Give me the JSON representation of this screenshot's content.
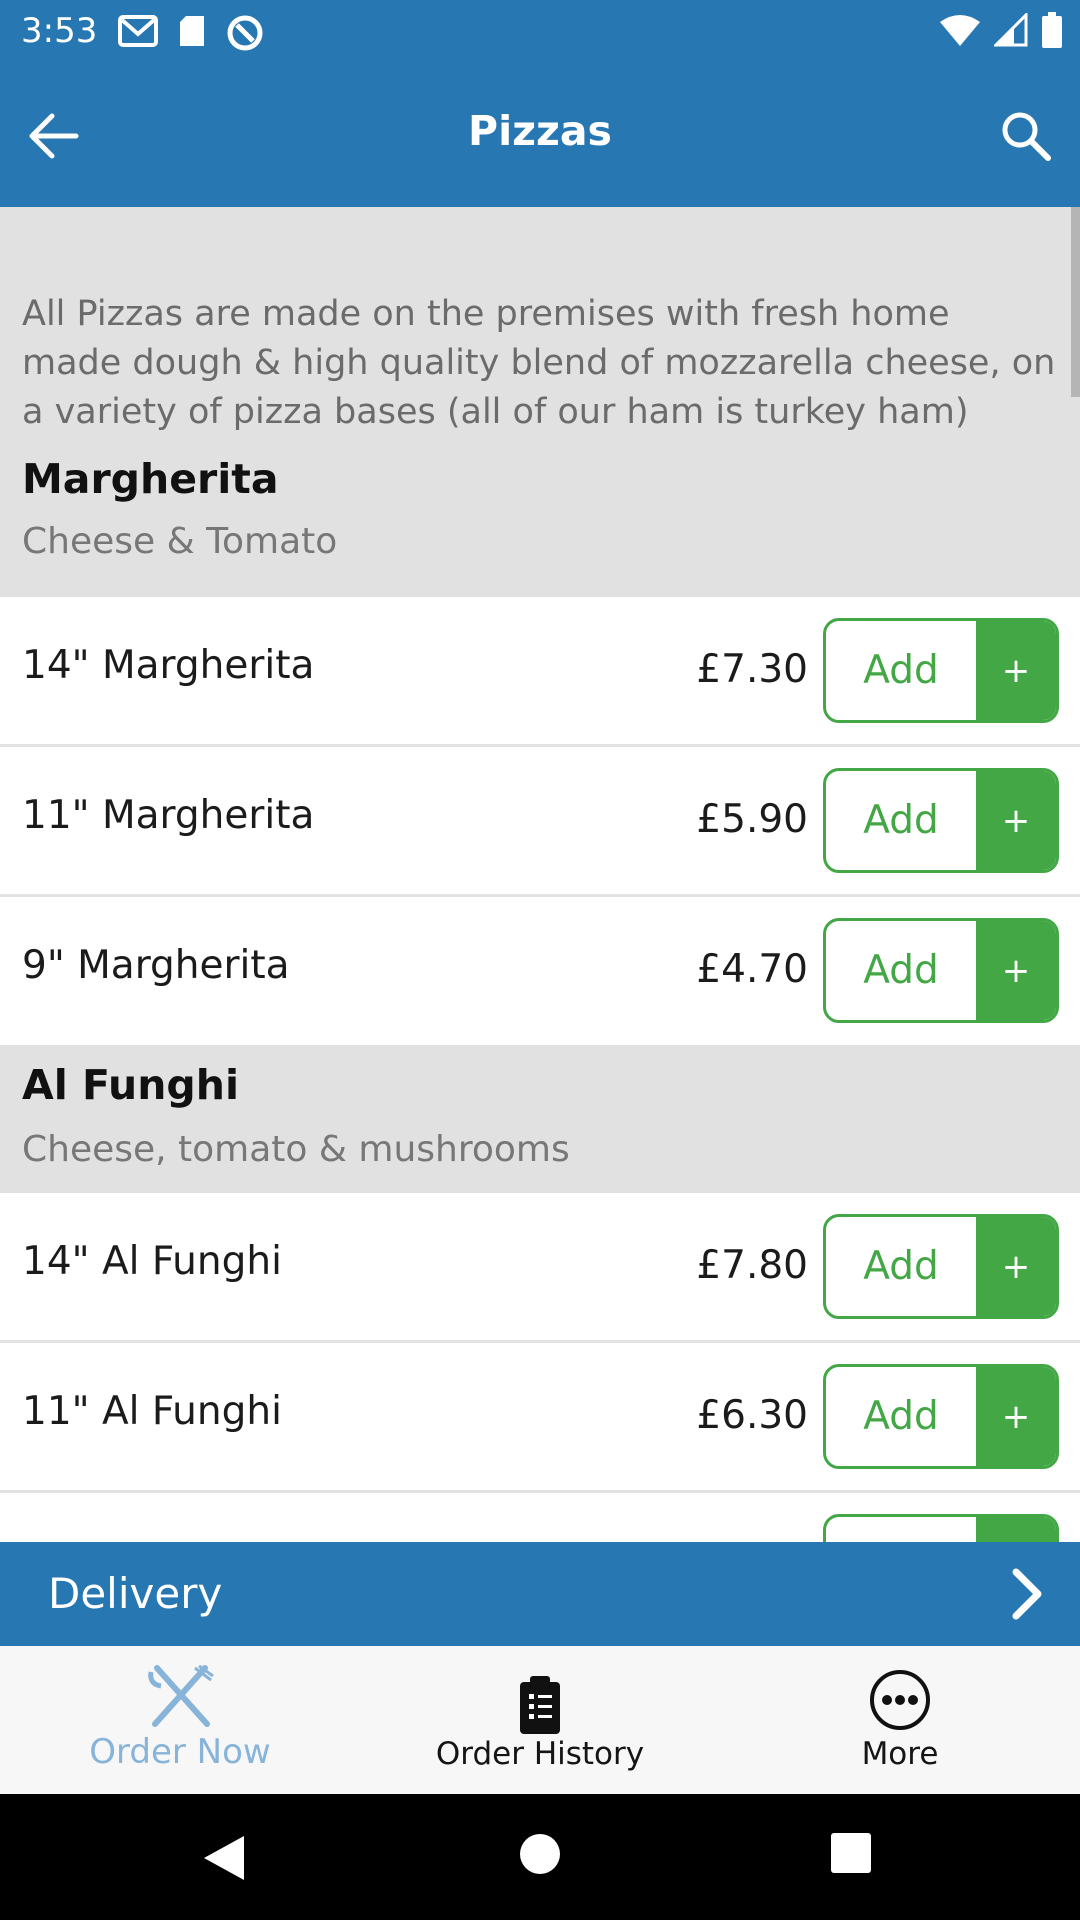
{
  "status_bar": {
    "time": "3:53"
  },
  "app_bar": {
    "title": "Pizzas"
  },
  "intro_text": "All Pizzas are made on the premises with fresh home made dough & high quality blend of mozzarella cheese, on a variety of pizza bases (all of our ham is turkey ham)",
  "sections": [
    {
      "name": "Margherita",
      "description": "Cheese & Tomato",
      "items": [
        {
          "name": "14\" Margherita",
          "price": "£7.30",
          "add_label": "Add",
          "plus": "+"
        },
        {
          "name": "11\" Margherita",
          "price": "£5.90",
          "add_label": "Add",
          "plus": "+"
        },
        {
          "name": "9\" Margherita",
          "price": "£4.70",
          "add_label": "Add",
          "plus": "+"
        }
      ]
    },
    {
      "name": "Al Funghi",
      "description": "Cheese, tomato & mushrooms",
      "items": [
        {
          "name": "14\" Al Funghi",
          "price": "£7.80",
          "add_label": "Add",
          "plus": "+"
        },
        {
          "name": "11\" Al Funghi",
          "price": "£6.30",
          "add_label": "Add",
          "plus": "+"
        }
      ]
    }
  ],
  "delivery": {
    "label": "Delivery"
  },
  "bottom_nav": [
    {
      "label": "Order Now",
      "icon": "fork-knife-icon",
      "active": true
    },
    {
      "label": "Order History",
      "icon": "clipboard-icon",
      "active": false
    },
    {
      "label": "More",
      "icon": "more-circle-icon",
      "active": false
    }
  ],
  "colors": {
    "primary": "#2777b2",
    "accent_green": "#43a745",
    "section_bg": "#e1e1e1",
    "nav_active": "#87b4d8"
  }
}
